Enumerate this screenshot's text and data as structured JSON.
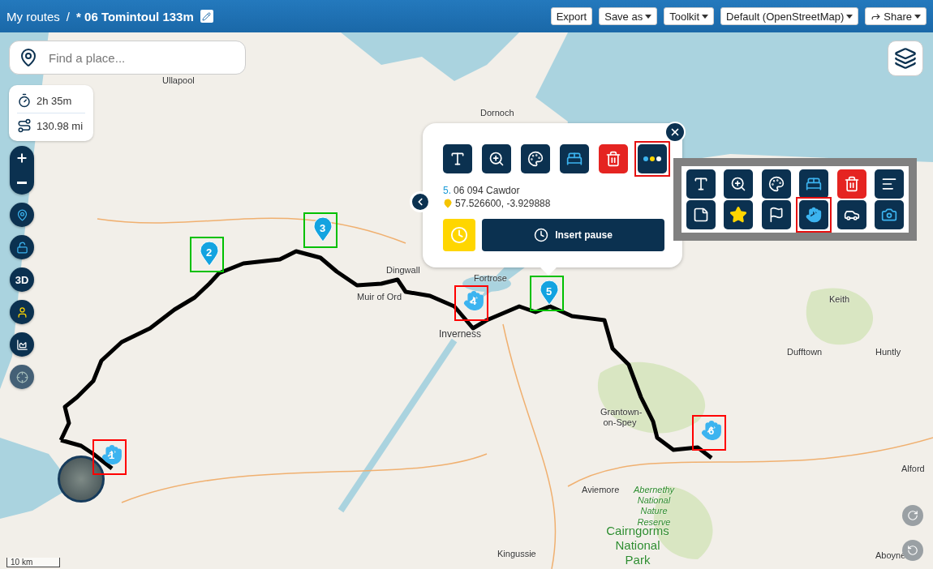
{
  "breadcrumb": {
    "root": "My routes",
    "separator": "/",
    "title": "* 06 Tomintoul 133m"
  },
  "header_buttons": [
    {
      "label": "Export",
      "kind": "plain"
    },
    {
      "label": "Save as",
      "kind": "menu"
    },
    {
      "label": "Toolkit",
      "kind": "menu"
    },
    {
      "label": "Default (OpenStreetMap)",
      "kind": "menu"
    },
    {
      "label": "Share",
      "kind": "share"
    }
  ],
  "search": {
    "placeholder": "Find a place..."
  },
  "stats": [
    {
      "kind": "time",
      "value": "2h 35m"
    },
    {
      "kind": "distance",
      "value": "130.98 mi"
    }
  ],
  "map_tools": [
    {
      "kind": "add-pin",
      "disabled": false
    },
    {
      "kind": "lock",
      "disabled": false
    },
    {
      "kind": "stereo",
      "label": "3D",
      "disabled": false
    },
    {
      "kind": "person",
      "disabled": false
    },
    {
      "kind": "elevation",
      "disabled": false
    },
    {
      "kind": "locate",
      "disabled": true
    }
  ],
  "place_labels": [
    {
      "text": "Ullapool",
      "kind": "town"
    },
    {
      "text": "Dornoch",
      "kind": "town"
    },
    {
      "text": "Dingwall",
      "kind": "town"
    },
    {
      "text": "Fortrose",
      "kind": "town"
    },
    {
      "text": "Muir of Ord",
      "kind": "town"
    },
    {
      "text": "Inverness",
      "kind": "city"
    },
    {
      "text": "Keith",
      "kind": "town"
    },
    {
      "text": "Dufftown",
      "kind": "town"
    },
    {
      "text": "Huntly",
      "kind": "town"
    },
    {
      "text": "Grantown-on-Spey",
      "kind": "town"
    },
    {
      "text": "Aviemore",
      "kind": "town"
    },
    {
      "text": "Abernethy National Nature Reserve",
      "kind": "reserve"
    },
    {
      "text": "Kingussie",
      "kind": "town"
    },
    {
      "text": "Cairngorms National Park",
      "kind": "park"
    },
    {
      "text": "Alford",
      "kind": "town"
    },
    {
      "text": "Aboyne",
      "kind": "town"
    }
  ],
  "markers": [
    {
      "number": "1",
      "kind": "hand",
      "color": "#ff0000"
    },
    {
      "number": "2",
      "kind": "pin",
      "color": "#00c000"
    },
    {
      "number": "3",
      "kind": "pin",
      "color": "#00c000"
    },
    {
      "number": "4",
      "kind": "hand",
      "color": "#ff0000"
    },
    {
      "number": "5",
      "kind": "pin",
      "color": "#00c000"
    },
    {
      "number": "6",
      "kind": "hand",
      "color": "#ff0000"
    }
  ],
  "popup": {
    "tools": [
      {
        "kind": "text",
        "selected": false
      },
      {
        "kind": "zoom",
        "selected": false
      },
      {
        "kind": "palette",
        "selected": false
      },
      {
        "kind": "bed",
        "selected": false
      },
      {
        "kind": "delete",
        "selected": false
      },
      {
        "kind": "more",
        "selected": true
      }
    ],
    "index": "5.",
    "name": "06 094 Cawdor",
    "coords": "57.526600, -3.929888",
    "pause_button": "Insert pause"
  },
  "toolkit": {
    "tools": [
      {
        "kind": "text",
        "selected": false
      },
      {
        "kind": "zoom",
        "selected": false
      },
      {
        "kind": "palette",
        "selected": false
      },
      {
        "kind": "bed",
        "selected": false
      },
      {
        "kind": "delete",
        "selected": false
      },
      {
        "kind": "summary",
        "selected": false
      },
      {
        "kind": "note",
        "selected": false
      },
      {
        "kind": "star",
        "selected": false
      },
      {
        "kind": "flag",
        "selected": false
      },
      {
        "kind": "hand",
        "selected": true
      },
      {
        "kind": "car",
        "selected": false
      },
      {
        "kind": "photo-pin",
        "selected": false
      }
    ]
  },
  "scale": "10 km"
}
